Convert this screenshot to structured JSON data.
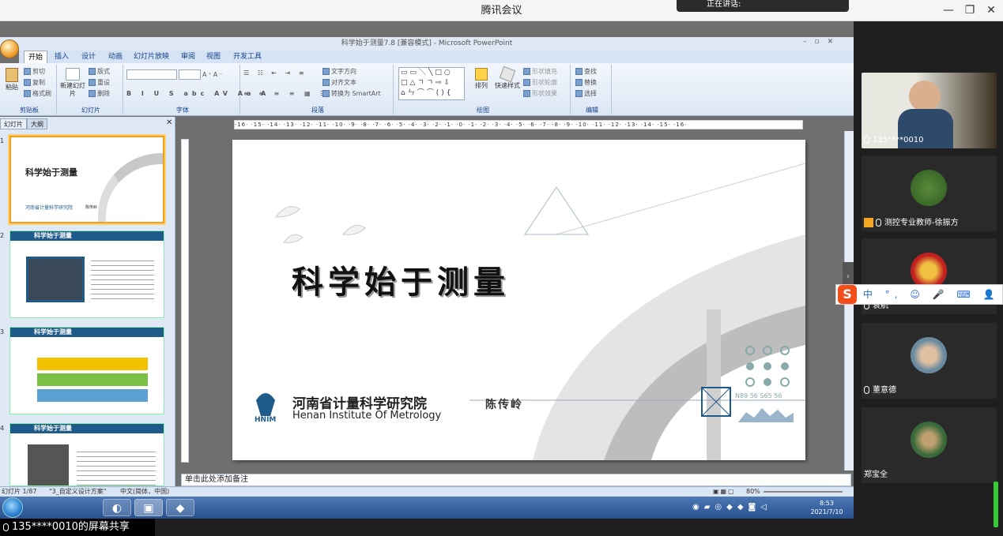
{
  "meeting": {
    "title": "腾讯会议",
    "speaking_label": "正在讲话:",
    "min_icon": "—",
    "restore_icon": "❐",
    "close_icon": "✕",
    "share_label": "135****0010的屏幕共享"
  },
  "ppt": {
    "window_title": "科学始于测量7.8 [兼容模式] - Microsoft PowerPoint",
    "tabs": [
      "开始",
      "插入",
      "设计",
      "动画",
      "幻灯片放映",
      "审阅",
      "视图",
      "开发工具"
    ],
    "groups": {
      "clipboard": {
        "label": "剪贴板",
        "paste": "粘贴",
        "cut": "剪切",
        "copy": "复制",
        "format_painter": "格式刷"
      },
      "slides": {
        "label": "幻灯片",
        "new_slide": "新建幻灯片",
        "layout": "版式",
        "reset": "重设",
        "delete": "删除"
      },
      "font": {
        "label": "字体"
      },
      "paragraph": {
        "label": "段落",
        "text_direction": "文字方向",
        "align_text": "对齐文本",
        "smartart": "转换为 SmartArt"
      },
      "drawing": {
        "label": "绘图",
        "arrange": "排列",
        "quick_styles": "快速样式",
        "shape_fill": "形状填充",
        "shape_outline": "形状轮廓",
        "shape_effects": "形状效果"
      },
      "editing": {
        "label": "编辑",
        "find": "查找",
        "replace": "替换",
        "select": "选择"
      }
    },
    "pane_tabs": [
      "幻灯片",
      "大纲"
    ],
    "ruler_text": "·16· ·15· ·14· ·13· ·12· ·11· ·10· ·9· ·8· ·7· ·6· ·5· ·4· ·3· ·2· ·1· ·0· ·1· ·2· ·3· ·4· ·5· ·6· ·7· ·8· ·9· ·10· ·11· ·12· ·13· ·14· ·15· ·16·",
    "slide": {
      "title": "科学始于测量",
      "org_cn": "河南省计量科学研究院",
      "org_en": "Henan Institute Of Metrology",
      "org_abbr": "HNIM",
      "presenter": "陈传岭",
      "code_text": "N89 56  S65 56"
    },
    "thumbs": [
      {
        "num": "1",
        "title": "科学始于测量",
        "org": "河南省计量科学研究院",
        "presenter": "陈传岭"
      },
      {
        "num": "2",
        "header": "科学始于测量"
      },
      {
        "num": "3",
        "header": "科学始于测量"
      },
      {
        "num": "4",
        "header": "科学始于测量"
      }
    ],
    "notes_placeholder": "单击此处添加备注",
    "status": {
      "slide": "幻灯片 1/87",
      "theme": "\"3_自定义设计方案\"",
      "lang": "中文(简体，中国)",
      "zoom": "80%"
    }
  },
  "taskbar": {
    "time": "8:53",
    "date": "2021/7/10"
  },
  "participants": [
    {
      "name": "135****0010"
    },
    {
      "name": "测控专业教师-徐振方"
    },
    {
      "name": "袁航"
    },
    {
      "name": "董意德"
    },
    {
      "name": "郑宝全"
    }
  ],
  "ime": {
    "logo": "S",
    "items": [
      "中",
      "°,",
      "☺",
      "🎤",
      "⌨",
      "👤",
      "👕",
      "⁘"
    ]
  },
  "colors": {
    "accent": "#1e5a8a",
    "ribbon": "#dce7f5",
    "ime_logo": "#f24d1a"
  }
}
